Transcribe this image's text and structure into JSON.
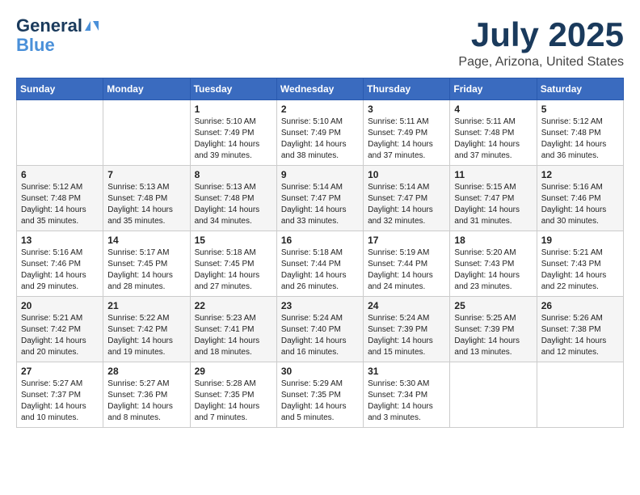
{
  "header": {
    "logo_line1": "General",
    "logo_line2": "Blue",
    "month": "July 2025",
    "location": "Page, Arizona, United States"
  },
  "weekdays": [
    "Sunday",
    "Monday",
    "Tuesday",
    "Wednesday",
    "Thursday",
    "Friday",
    "Saturday"
  ],
  "weeks": [
    [
      {
        "day": "",
        "sunrise": "",
        "sunset": "",
        "daylight": ""
      },
      {
        "day": "",
        "sunrise": "",
        "sunset": "",
        "daylight": ""
      },
      {
        "day": "1",
        "sunrise": "Sunrise: 5:10 AM",
        "sunset": "Sunset: 7:49 PM",
        "daylight": "Daylight: 14 hours and 39 minutes."
      },
      {
        "day": "2",
        "sunrise": "Sunrise: 5:10 AM",
        "sunset": "Sunset: 7:49 PM",
        "daylight": "Daylight: 14 hours and 38 minutes."
      },
      {
        "day": "3",
        "sunrise": "Sunrise: 5:11 AM",
        "sunset": "Sunset: 7:49 PM",
        "daylight": "Daylight: 14 hours and 37 minutes."
      },
      {
        "day": "4",
        "sunrise": "Sunrise: 5:11 AM",
        "sunset": "Sunset: 7:48 PM",
        "daylight": "Daylight: 14 hours and 37 minutes."
      },
      {
        "day": "5",
        "sunrise": "Sunrise: 5:12 AM",
        "sunset": "Sunset: 7:48 PM",
        "daylight": "Daylight: 14 hours and 36 minutes."
      }
    ],
    [
      {
        "day": "6",
        "sunrise": "Sunrise: 5:12 AM",
        "sunset": "Sunset: 7:48 PM",
        "daylight": "Daylight: 14 hours and 35 minutes."
      },
      {
        "day": "7",
        "sunrise": "Sunrise: 5:13 AM",
        "sunset": "Sunset: 7:48 PM",
        "daylight": "Daylight: 14 hours and 35 minutes."
      },
      {
        "day": "8",
        "sunrise": "Sunrise: 5:13 AM",
        "sunset": "Sunset: 7:48 PM",
        "daylight": "Daylight: 14 hours and 34 minutes."
      },
      {
        "day": "9",
        "sunrise": "Sunrise: 5:14 AM",
        "sunset": "Sunset: 7:47 PM",
        "daylight": "Daylight: 14 hours and 33 minutes."
      },
      {
        "day": "10",
        "sunrise": "Sunrise: 5:14 AM",
        "sunset": "Sunset: 7:47 PM",
        "daylight": "Daylight: 14 hours and 32 minutes."
      },
      {
        "day": "11",
        "sunrise": "Sunrise: 5:15 AM",
        "sunset": "Sunset: 7:47 PM",
        "daylight": "Daylight: 14 hours and 31 minutes."
      },
      {
        "day": "12",
        "sunrise": "Sunrise: 5:16 AM",
        "sunset": "Sunset: 7:46 PM",
        "daylight": "Daylight: 14 hours and 30 minutes."
      }
    ],
    [
      {
        "day": "13",
        "sunrise": "Sunrise: 5:16 AM",
        "sunset": "Sunset: 7:46 PM",
        "daylight": "Daylight: 14 hours and 29 minutes."
      },
      {
        "day": "14",
        "sunrise": "Sunrise: 5:17 AM",
        "sunset": "Sunset: 7:45 PM",
        "daylight": "Daylight: 14 hours and 28 minutes."
      },
      {
        "day": "15",
        "sunrise": "Sunrise: 5:18 AM",
        "sunset": "Sunset: 7:45 PM",
        "daylight": "Daylight: 14 hours and 27 minutes."
      },
      {
        "day": "16",
        "sunrise": "Sunrise: 5:18 AM",
        "sunset": "Sunset: 7:44 PM",
        "daylight": "Daylight: 14 hours and 26 minutes."
      },
      {
        "day": "17",
        "sunrise": "Sunrise: 5:19 AM",
        "sunset": "Sunset: 7:44 PM",
        "daylight": "Daylight: 14 hours and 24 minutes."
      },
      {
        "day": "18",
        "sunrise": "Sunrise: 5:20 AM",
        "sunset": "Sunset: 7:43 PM",
        "daylight": "Daylight: 14 hours and 23 minutes."
      },
      {
        "day": "19",
        "sunrise": "Sunrise: 5:21 AM",
        "sunset": "Sunset: 7:43 PM",
        "daylight": "Daylight: 14 hours and 22 minutes."
      }
    ],
    [
      {
        "day": "20",
        "sunrise": "Sunrise: 5:21 AM",
        "sunset": "Sunset: 7:42 PM",
        "daylight": "Daylight: 14 hours and 20 minutes."
      },
      {
        "day": "21",
        "sunrise": "Sunrise: 5:22 AM",
        "sunset": "Sunset: 7:42 PM",
        "daylight": "Daylight: 14 hours and 19 minutes."
      },
      {
        "day": "22",
        "sunrise": "Sunrise: 5:23 AM",
        "sunset": "Sunset: 7:41 PM",
        "daylight": "Daylight: 14 hours and 18 minutes."
      },
      {
        "day": "23",
        "sunrise": "Sunrise: 5:24 AM",
        "sunset": "Sunset: 7:40 PM",
        "daylight": "Daylight: 14 hours and 16 minutes."
      },
      {
        "day": "24",
        "sunrise": "Sunrise: 5:24 AM",
        "sunset": "Sunset: 7:39 PM",
        "daylight": "Daylight: 14 hours and 15 minutes."
      },
      {
        "day": "25",
        "sunrise": "Sunrise: 5:25 AM",
        "sunset": "Sunset: 7:39 PM",
        "daylight": "Daylight: 14 hours and 13 minutes."
      },
      {
        "day": "26",
        "sunrise": "Sunrise: 5:26 AM",
        "sunset": "Sunset: 7:38 PM",
        "daylight": "Daylight: 14 hours and 12 minutes."
      }
    ],
    [
      {
        "day": "27",
        "sunrise": "Sunrise: 5:27 AM",
        "sunset": "Sunset: 7:37 PM",
        "daylight": "Daylight: 14 hours and 10 minutes."
      },
      {
        "day": "28",
        "sunrise": "Sunrise: 5:27 AM",
        "sunset": "Sunset: 7:36 PM",
        "daylight": "Daylight: 14 hours and 8 minutes."
      },
      {
        "day": "29",
        "sunrise": "Sunrise: 5:28 AM",
        "sunset": "Sunset: 7:35 PM",
        "daylight": "Daylight: 14 hours and 7 minutes."
      },
      {
        "day": "30",
        "sunrise": "Sunrise: 5:29 AM",
        "sunset": "Sunset: 7:35 PM",
        "daylight": "Daylight: 14 hours and 5 minutes."
      },
      {
        "day": "31",
        "sunrise": "Sunrise: 5:30 AM",
        "sunset": "Sunset: 7:34 PM",
        "daylight": "Daylight: 14 hours and 3 minutes."
      },
      {
        "day": "",
        "sunrise": "",
        "sunset": "",
        "daylight": ""
      },
      {
        "day": "",
        "sunrise": "",
        "sunset": "",
        "daylight": ""
      }
    ]
  ]
}
